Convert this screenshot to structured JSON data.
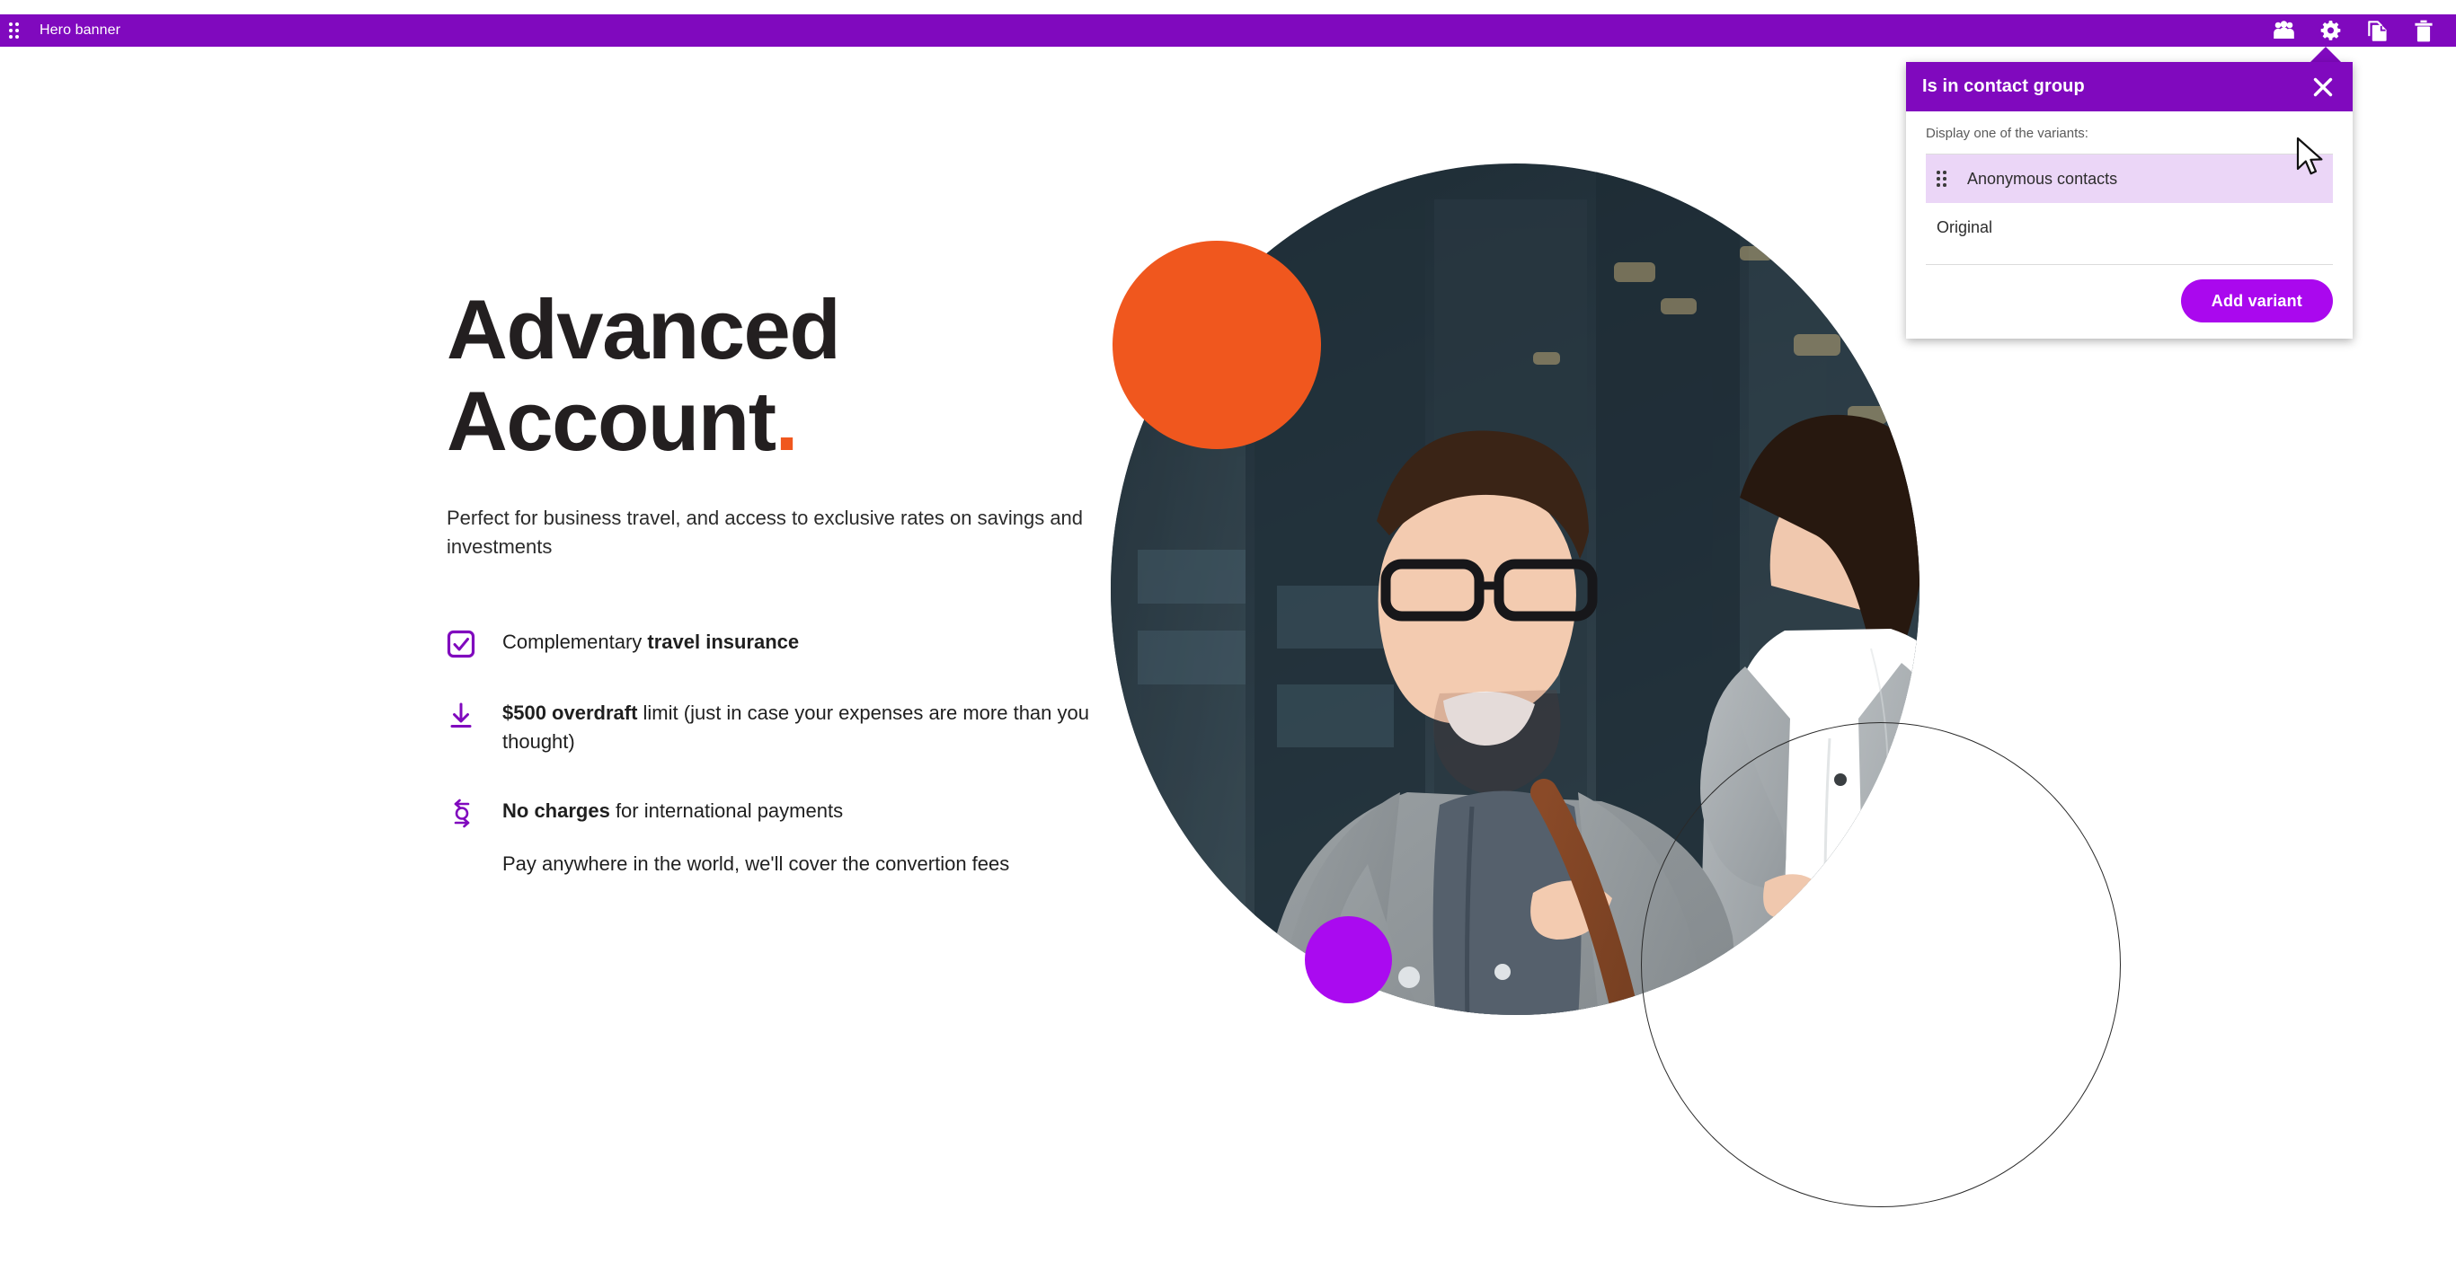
{
  "editor_bar": {
    "drag_handle_icon": "drag-handle-icon",
    "title": "Hero banner",
    "accent_color": "#8009BE",
    "tools": [
      {
        "name": "contact-group-icon",
        "label": "Contact group"
      },
      {
        "name": "gear-icon",
        "label": "Settings"
      },
      {
        "name": "duplicate-icon",
        "label": "Duplicate"
      },
      {
        "name": "trash-icon",
        "label": "Delete"
      }
    ]
  },
  "popup": {
    "title": "Is in contact group",
    "close_icon": "close-icon",
    "hint": "Display one of the variants:",
    "variants": [
      {
        "label": "Anonymous contacts",
        "selected": true,
        "handle_icon": "drag-handle-icon"
      },
      {
        "label": "Original",
        "selected": false,
        "handle_icon": "drag-handle-icon"
      }
    ],
    "add_button_label": "Add variant",
    "header_color": "#8009BE",
    "button_color": "#AA08EE",
    "selected_row_color": "#EBD6F7"
  },
  "hero": {
    "heading_line1": "Advanced",
    "heading_line2": "Account",
    "heading_dot": ".",
    "heading_dot_color": "#F0571E",
    "subheading": "Perfect for business travel, and access to exclusive rates on savings and investments",
    "features": [
      {
        "icon": "checkbox-check-icon",
        "text_prefix": "Complementary ",
        "text_bold": "travel insurance",
        "text_suffix": "",
        "note": ""
      },
      {
        "icon": "download-arrow-icon",
        "text_prefix": "",
        "text_bold": "$500 overdraft",
        "text_suffix": " limit (just in case your expenses are more than you thought)",
        "note": ""
      },
      {
        "icon": "currency-exchange-icon",
        "text_prefix": "",
        "text_bold": "No charges",
        "text_suffix": " for international payments",
        "note": "Pay anywhere in the world, we'll cover the convertion fees"
      }
    ],
    "decor": {
      "orange_circle_color": "#F0571E",
      "purple_circle_color": "#AA0AF0",
      "outline_circle_color": "#2a2a2a"
    },
    "photo_alt": "Two smiling business people walking in a city"
  }
}
